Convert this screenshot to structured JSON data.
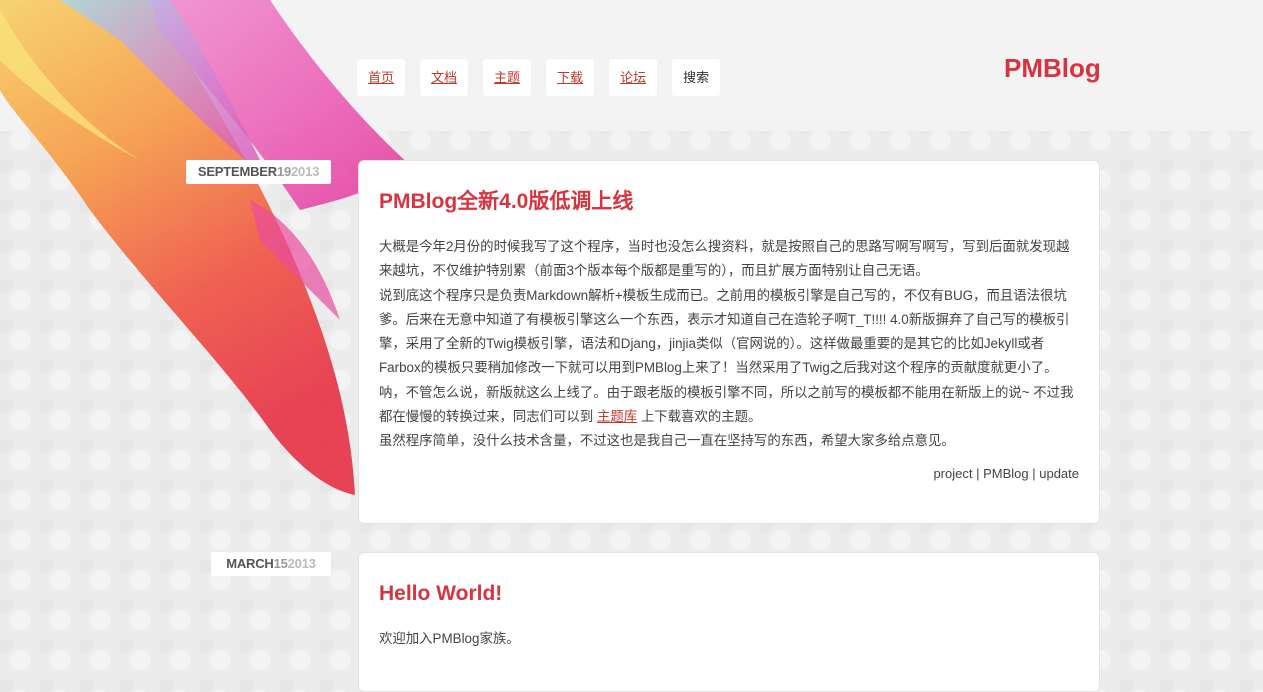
{
  "nav": {
    "items": [
      {
        "label": "首页"
      },
      {
        "label": "文档"
      },
      {
        "label": "主题"
      },
      {
        "label": "下载"
      },
      {
        "label": "论坛"
      }
    ],
    "search_label": "搜索"
  },
  "brand": "PMBlog",
  "posts": [
    {
      "date": {
        "month": "SEPTEMBER",
        "day": "19",
        "year": "2013"
      },
      "title": "PMBlog全新4.0版低调上线",
      "paragraphs": [
        "大概是今年2月份的时候我写了这个程序，当时也没怎么搜资料，就是按照自己的思路写啊写啊写，写到后面就发现越来越坑，不仅维护特别累（前面3个版本每个版都是重写的），而且扩展方面特别让自己无语。",
        "说到底这个程序只是负责Markdown解析+模板生成而已。之前用的模板引擎是自己写的，不仅有BUG，而且语法很坑爹。后来在无意中知道了有模板引擎这么一个东西，表示才知道自己在造轮子啊T_T!!!! 4.0新版摒弃了自己写的模板引擎，采用了全新的Twig模板引擎，语法和Djang，jinjia类似（官网说的）。这样做最重要的是其它的比如Jekyll或者Farbox的模板只要稍加修改一下就可以用到PMBlog上来了！当然采用了Twig之后我对这个程序的贡献度就更小了。"
      ],
      "para3_before": "呐，不管怎么说，新版就这么上线了。由于跟老版的模板引擎不同，所以之前写的模板都不能用在新版上的说~ 不过我都在慢慢的转换过来，同志们可以到 ",
      "para3_link": "主题库",
      "para3_after": " 上下载喜欢的主题。",
      "para4": "虽然程序简单，没什么技术含量，不过这也是我自己一直在坚持写的东西，希望大家多给点意见。",
      "tags": [
        "project",
        "PMBlog",
        "update"
      ],
      "tag_sep": " | "
    },
    {
      "date": {
        "month": "MARCH",
        "day": "15",
        "year": "2013"
      },
      "title": "Hello World!",
      "paragraphs": [
        "欢迎加入PMBlog家族。"
      ]
    }
  ],
  "colors": {
    "accent": "#d8343f",
    "link": "#c0392b",
    "background": "#ececec"
  }
}
